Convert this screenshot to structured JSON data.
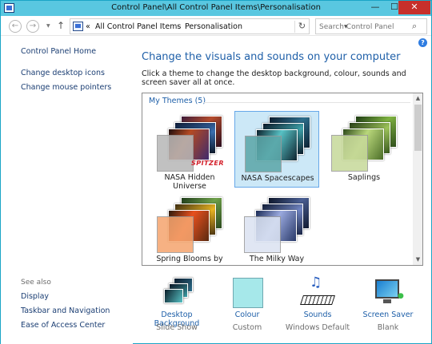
{
  "window": {
    "title": "Control Panel\\All Control Panel Items\\Personalisation",
    "minimize": "—",
    "maximize": "☐",
    "close": "✕"
  },
  "nav": {
    "back": "←",
    "forward": "→",
    "up": "↑",
    "breadcrumb_lead": "«",
    "breadcrumbs": [
      "All Control Panel Items",
      "Personalisation"
    ],
    "separator": "›",
    "refresh": "↻",
    "search_placeholder": "Search Control Panel",
    "search_icon": "⌕"
  },
  "help": "?",
  "sidebar": {
    "home": "Control Panel Home",
    "links": [
      "Change desktop icons",
      "Change mouse pointers"
    ],
    "see_also_title": "See also",
    "see_also": [
      "Display",
      "Taskbar and Navigation",
      "Ease of Access Center"
    ]
  },
  "main": {
    "title": "Change the visuals and sounds on your computer",
    "description": "Click a theme to change the desktop background, colour, sounds and screen saver all at once.",
    "group_title": "My Themes (5)",
    "themes": [
      {
        "name": "NASA Hidden Universe",
        "selected": false,
        "badge": "SPITZER",
        "swatch": "#b8b8b8"
      },
      {
        "name": "NASA Spacescapes",
        "selected": true,
        "swatch": "#5ca6a8"
      },
      {
        "name": "Saplings",
        "selected": false,
        "swatch": "#c7d99a"
      },
      {
        "name": "Spring Blooms by",
        "selected": false,
        "swatch": "#f5a56f"
      },
      {
        "name": "The Milky Way",
        "selected": false,
        "swatch": "#dbe3f2"
      }
    ]
  },
  "options": [
    {
      "name": "Desktop Background",
      "value": "Slide Show",
      "icon": "desktop-background-icon"
    },
    {
      "name": "Colour",
      "value": "Custom",
      "icon": "colour-swatch-icon",
      "color": "#a6e8ea"
    },
    {
      "name": "Sounds",
      "value": "Windows Default",
      "icon": "sounds-icon"
    },
    {
      "name": "Screen Saver",
      "value": "Blank",
      "icon": "screen-saver-icon"
    }
  ]
}
